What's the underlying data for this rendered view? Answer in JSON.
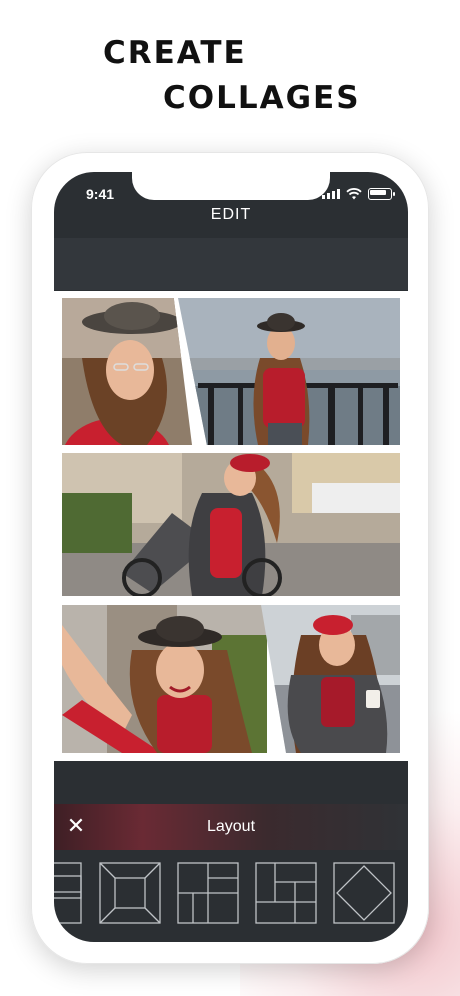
{
  "headline": {
    "line1": "CREATE",
    "line2": "COLLAGES"
  },
  "status_bar": {
    "time": "9:41"
  },
  "editor": {
    "title": "EDIT",
    "layout_label": "Layout",
    "close_icon": "close-icon"
  },
  "colors": {
    "screen_bg": "#2b2f33",
    "accent_red": "#c8202f",
    "toolbar_gradient": "#6a2a34"
  },
  "layout_options": [
    {
      "icon": "layout-partial-icon"
    },
    {
      "icon": "layout-x-frame-icon"
    },
    {
      "icon": "layout-grid-four-icon"
    },
    {
      "icon": "layout-grid-mixed-icon"
    },
    {
      "icon": "layout-diamond-icon"
    }
  ]
}
